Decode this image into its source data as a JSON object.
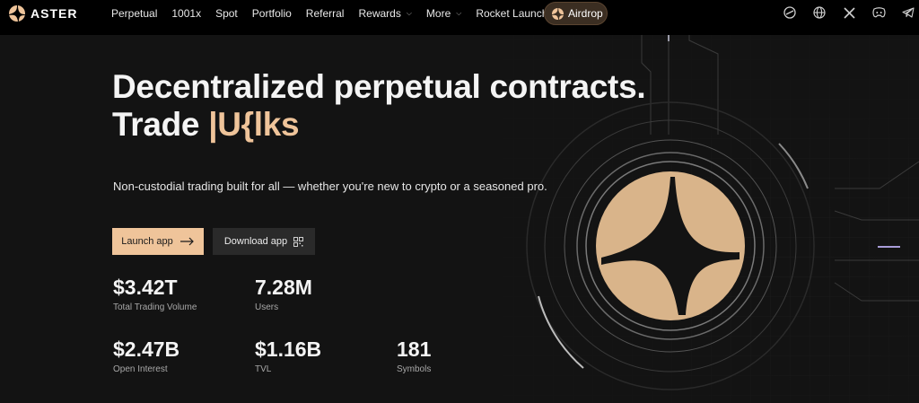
{
  "brand": {
    "name": "ASTER",
    "color": "#efc49a"
  },
  "nav": {
    "items": [
      {
        "label": "Perpetual",
        "dropdown": false
      },
      {
        "label": "1001x",
        "dropdown": false
      },
      {
        "label": "Spot",
        "dropdown": false
      },
      {
        "label": "Portfolio",
        "dropdown": false
      },
      {
        "label": "Referral",
        "dropdown": false
      },
      {
        "label": "Rewards",
        "dropdown": true
      },
      {
        "label": "More",
        "dropdown": true
      },
      {
        "label": "Rocket Launch",
        "dropdown": false,
        "badge": "fire-icon"
      }
    ],
    "airdrop_label": "Airdrop"
  },
  "social_icons": [
    "support-icon",
    "globe-icon",
    "x-icon",
    "discord-icon",
    "telegram-icon"
  ],
  "hero": {
    "title_line1": "Decentralized perpetual contracts.",
    "title_line2_prefix": "Trade ",
    "title_line2_accent": "|U{lks",
    "subtitle": "Non-custodial trading built for all — whether you're new to crypto or a seasoned pro."
  },
  "buttons": {
    "launch_app": "Launch app",
    "download_app": "Download app"
  },
  "stats": [
    {
      "value": "$3.42T",
      "label": "Total Trading Volume"
    },
    {
      "value": "7.28M",
      "label": "Users"
    },
    {
      "value": "$2.47B",
      "label": "Open Interest"
    },
    {
      "value": "$1.16B",
      "label": "TVL"
    },
    {
      "value": "181",
      "label": "Symbols"
    }
  ]
}
